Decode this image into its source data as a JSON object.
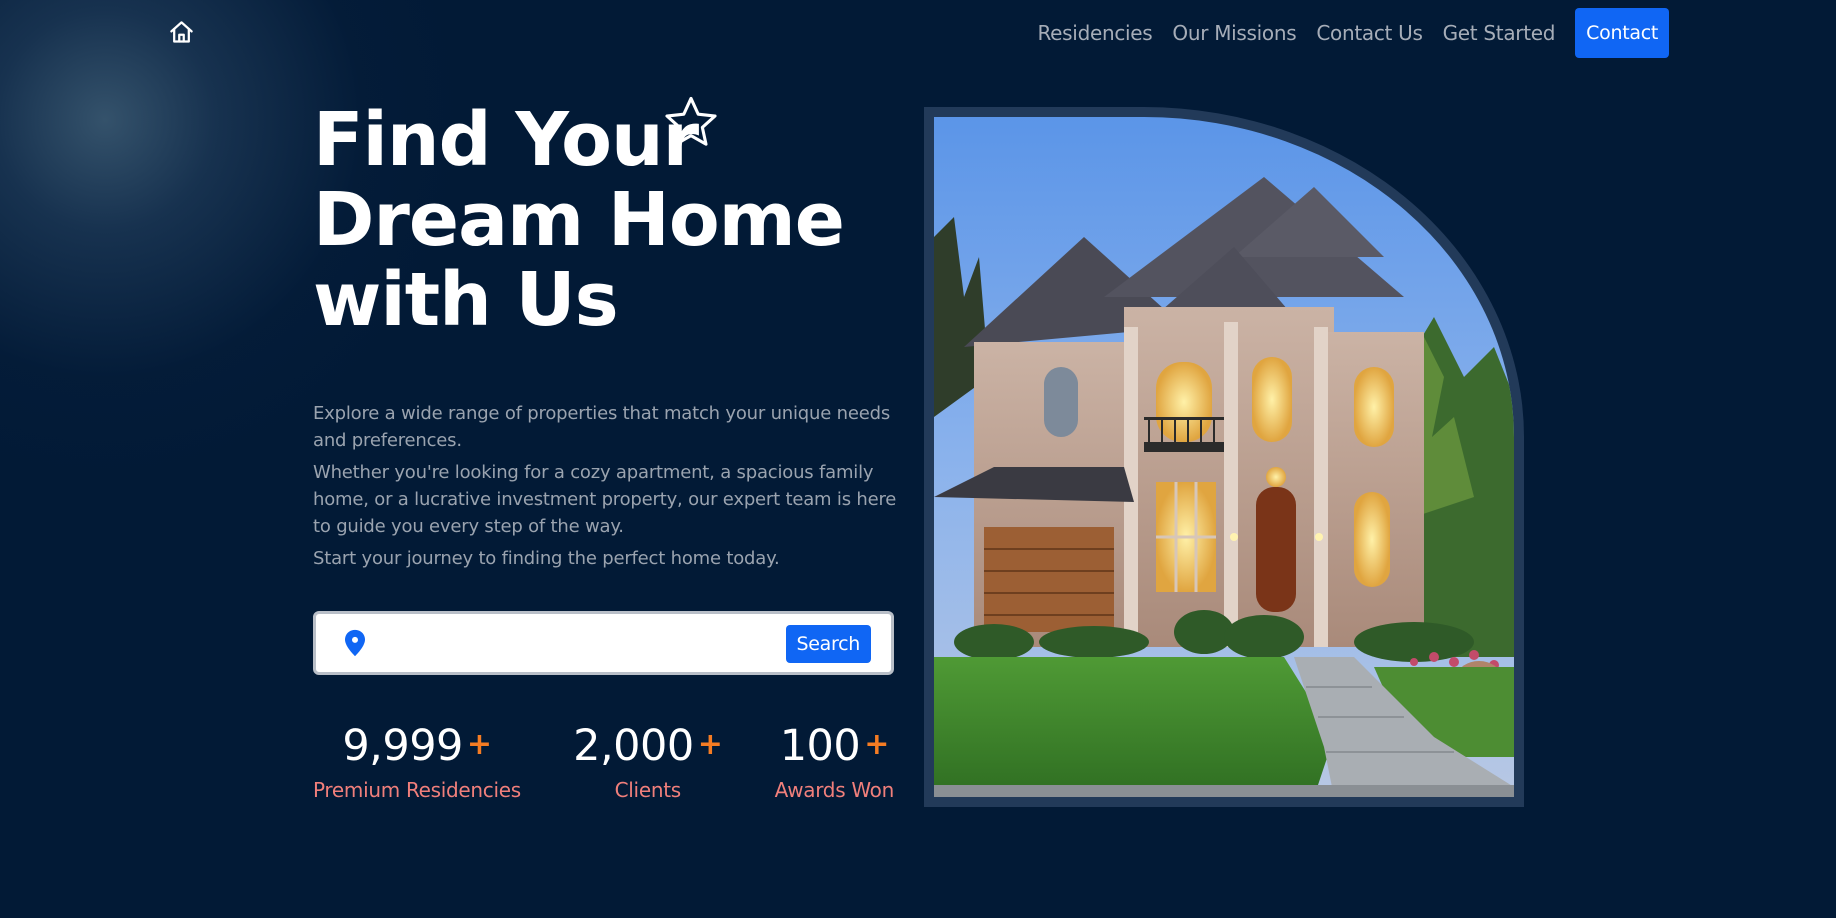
{
  "nav": {
    "home_icon": "home-icon",
    "links": [
      "Residencies",
      "Our Missions",
      "Contact Us",
      "Get Started"
    ],
    "contact_label": "Contact",
    "accent_color": "#1066f4"
  },
  "hero": {
    "title_lines": [
      "Find Your",
      "Dream Home",
      "with Us"
    ],
    "star_icon": "star-icon",
    "paragraphs": [
      "Explore a wide range of properties that match your unique needs and preferences.",
      "Whether you're looking for a cozy apartment, a spacious family home, or a lucrative investment property, our expert team is here to guide you every step of the way.",
      "Start your journey to finding the perfect home today."
    ]
  },
  "search": {
    "icon": "location-pin-icon",
    "input_value": "",
    "placeholder": "",
    "button_label": "Search"
  },
  "stats": [
    {
      "value": "9,999",
      "suffix": "+",
      "label": "Premium Residencies"
    },
    {
      "value": "2,000",
      "suffix": "+",
      "label": "Clients"
    },
    {
      "value": "100",
      "suffix": "+",
      "label": "Awards Won"
    }
  ],
  "image": {
    "subject": "house-photo"
  },
  "colors": {
    "background": "#021a36",
    "stat_plus": "#f57c23",
    "stat_label": "#f07f7b",
    "frame": "#223a59"
  }
}
